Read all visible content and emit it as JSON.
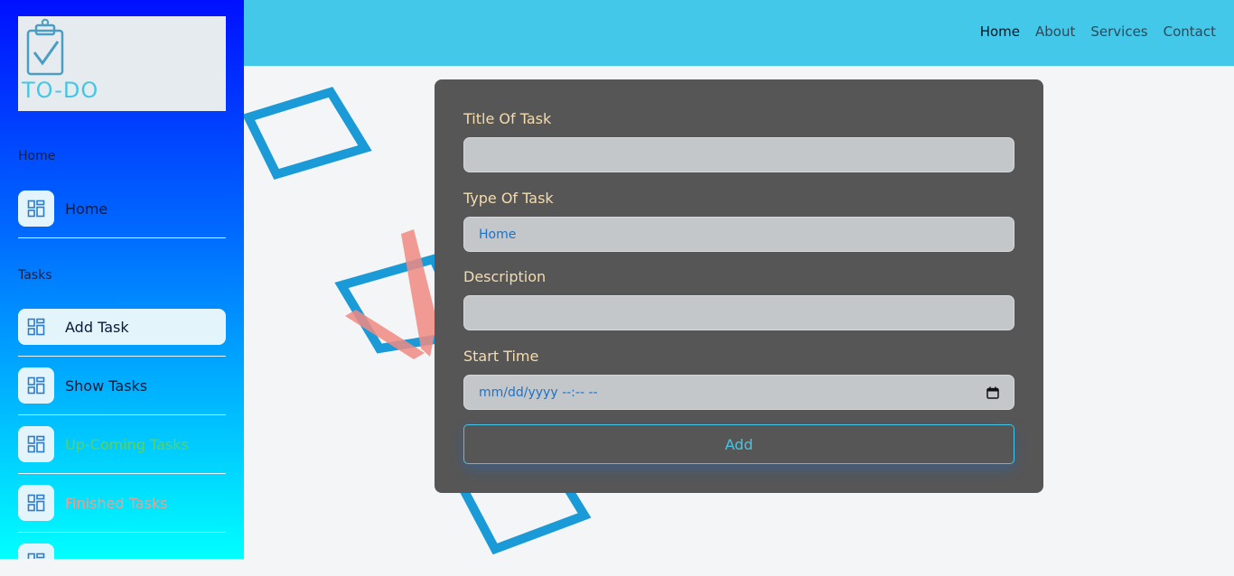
{
  "app": {
    "logo_text": "TO-DO"
  },
  "topnav": [
    "Home",
    "About",
    "Services",
    "Contact"
  ],
  "sidebar": {
    "section_home": "Home",
    "home_item": "Home",
    "section_tasks": "Tasks",
    "items": [
      "Add Task",
      "Show Tasks",
      "Up-Coming Tasks",
      "Finished Tasks"
    ]
  },
  "form": {
    "title_label": "Title Of Task",
    "title_value": "",
    "type_label": "Type Of Task",
    "type_value": "Home",
    "description_label": "Description",
    "description_value": "",
    "start_label": "Start Time",
    "start_placeholder": "mm/dd/yyyy --:-- --",
    "add_button": "Add"
  },
  "colors": {
    "accent": "#44c8ea",
    "card": "#565656",
    "label": "#f4dcae",
    "upcoming": "#5ed25e",
    "finished": "#f59a8c"
  }
}
